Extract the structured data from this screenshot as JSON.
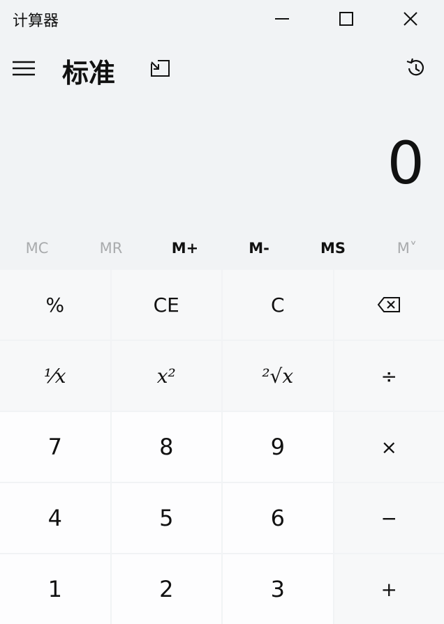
{
  "window": {
    "title": "计算器"
  },
  "header": {
    "mode_title": "标准"
  },
  "display": {
    "value": "0"
  },
  "memory": [
    {
      "label": "MC",
      "enabled": false
    },
    {
      "label": "MR",
      "enabled": false
    },
    {
      "label": "M+",
      "enabled": true
    },
    {
      "label": "M-",
      "enabled": true
    },
    {
      "label": "MS",
      "enabled": true
    },
    {
      "label": "M˅",
      "enabled": false
    }
  ],
  "keys": {
    "percent": "%",
    "ce": "CE",
    "clear": "C",
    "reciprocal": "⅟x",
    "square": "x²",
    "sqrt": "²√x",
    "divide": "÷",
    "n7": "7",
    "n8": "8",
    "n9": "9",
    "multiply": "×",
    "n4": "4",
    "n5": "5",
    "n6": "6",
    "minus": "−",
    "n1": "1",
    "n2": "2",
    "n3": "3",
    "plus": "+"
  },
  "icons": {
    "minimize": "minimize-icon",
    "maximize": "maximize-icon",
    "close": "close-icon",
    "menu": "hamburger-menu-icon",
    "keep_on_top": "keep-on-top-icon",
    "history": "history-icon",
    "backspace": "backspace-icon"
  },
  "colors": {
    "background": "#f1f3f5",
    "function_key": "#f7f8f9",
    "number_key": "#fdfdfe",
    "disabled_text": "#a9abad",
    "text": "#111111"
  }
}
